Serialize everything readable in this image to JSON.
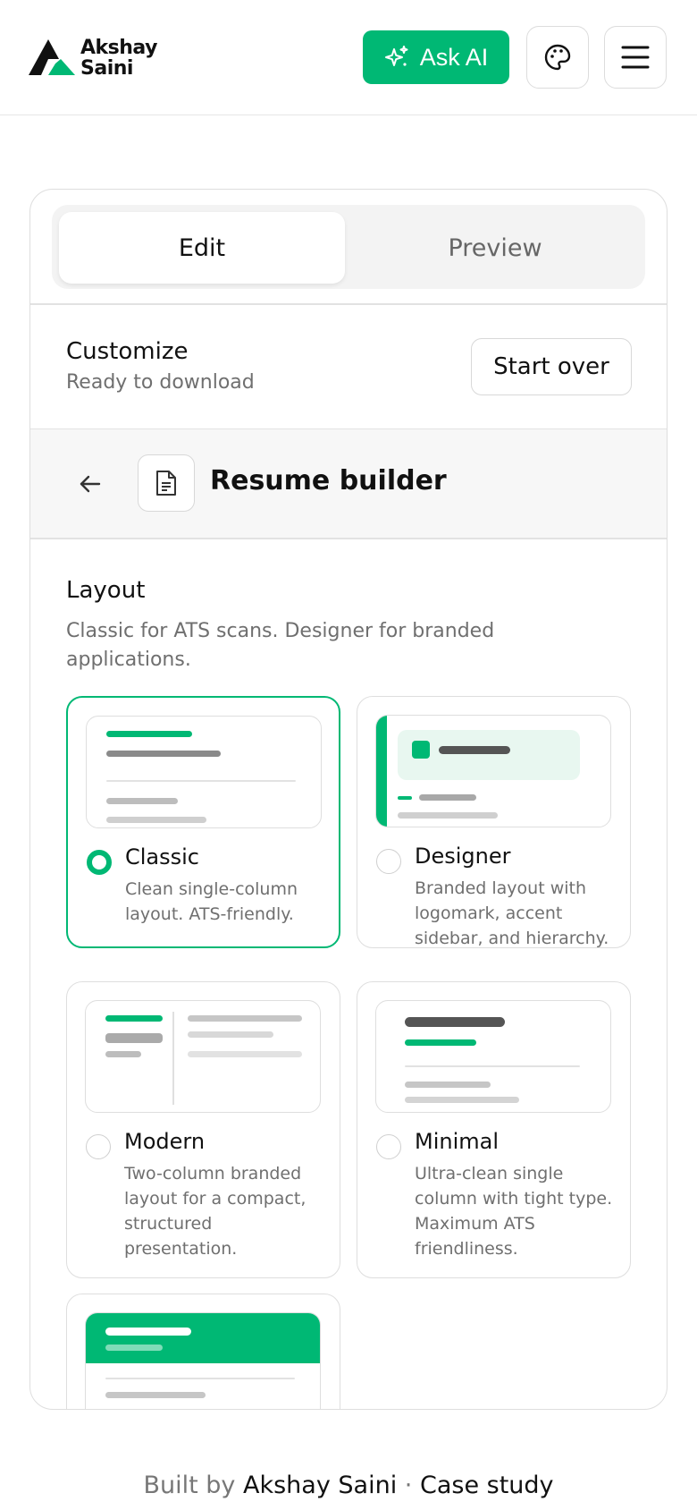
{
  "header": {
    "logo_line1": "Akshay",
    "logo_line2": "Saini",
    "ask_ai_label": "Ask AI"
  },
  "tabs": [
    {
      "label": "Edit",
      "active": true
    },
    {
      "label": "Preview",
      "active": false
    }
  ],
  "customize": {
    "title": "Customize",
    "status": "Ready to download",
    "start_over_label": "Start over"
  },
  "builder": {
    "title": "Resume builder"
  },
  "layout": {
    "title": "Layout",
    "description": "Classic for ATS scans. Designer for branded applications.",
    "options": [
      {
        "name": "Classic",
        "description": "Clean single-column layout. ATS-friendly.",
        "selected": true
      },
      {
        "name": "Designer",
        "description": "Branded layout with logomark, accent sidebar, and hierarchy.",
        "selected": false
      },
      {
        "name": "Modern",
        "description": "Two-column branded layout for a compact, structured presentation.",
        "selected": false
      },
      {
        "name": "Minimal",
        "description": "Ultra-clean single column with tight type. Maximum ATS friendliness.",
        "selected": false
      }
    ]
  },
  "footer": {
    "prefix": "Built by",
    "author": "Akshay Saini",
    "separator": "·",
    "case_study": "Case study"
  },
  "colors": {
    "accent": "#00b874",
    "accent_light": "#e8f7f0",
    "text": "#111111",
    "muted": "#6f6f6f",
    "border": "#dedede"
  },
  "icons": [
    "logo-mark-icon",
    "sparkle-icon",
    "palette-icon",
    "menu-icon",
    "arrow-left-icon",
    "document-icon"
  ]
}
